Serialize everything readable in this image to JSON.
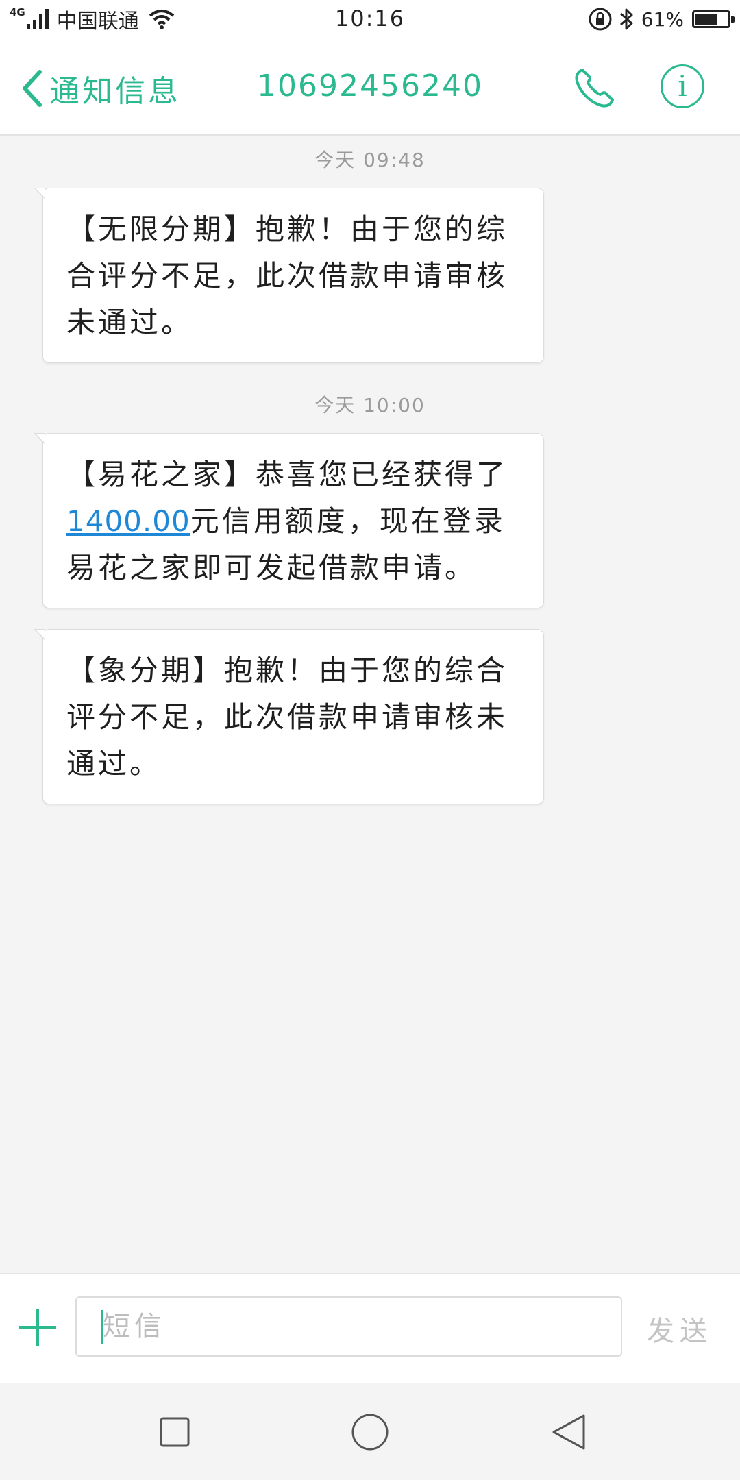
{
  "status_bar": {
    "network_type": "4G",
    "carrier": "中国联通",
    "time": "10:16",
    "battery_percent": "61%",
    "battery_level": 0.61,
    "icons": [
      "signal-icon",
      "wifi-icon",
      "rotation-lock-icon",
      "bluetooth-icon",
      "battery-icon"
    ]
  },
  "header": {
    "back_label": "通知信息",
    "phone_number": "10692456240",
    "accent_color": "#2bb98f",
    "icons": [
      "back-chevron-icon",
      "phone-call-icon",
      "info-icon"
    ]
  },
  "conversation": {
    "timestamps": [
      "今天 09:48",
      "今天 10:00"
    ],
    "messages": [
      {
        "text": "【无限分期】抱歉！由于您的综合评分不足，此次借款申请审核未通过。"
      },
      {
        "text_before": "【易花之家】恭喜您已经获得了",
        "link": "1400.00",
        "text_after": "元信用额度，现在登录易花之家即可发起借款申请。"
      },
      {
        "text": "【象分期】抱歉！由于您的综合评分不足，此次借款申请审核未通过。"
      }
    ],
    "link_color": "#1e88d6"
  },
  "compose": {
    "placeholder": "短信",
    "value": "",
    "send_label": "发送",
    "icons": [
      "add-icon"
    ]
  },
  "nav_bar": {
    "icons": [
      "recent-apps-icon",
      "home-icon",
      "back-triangle-icon"
    ]
  }
}
